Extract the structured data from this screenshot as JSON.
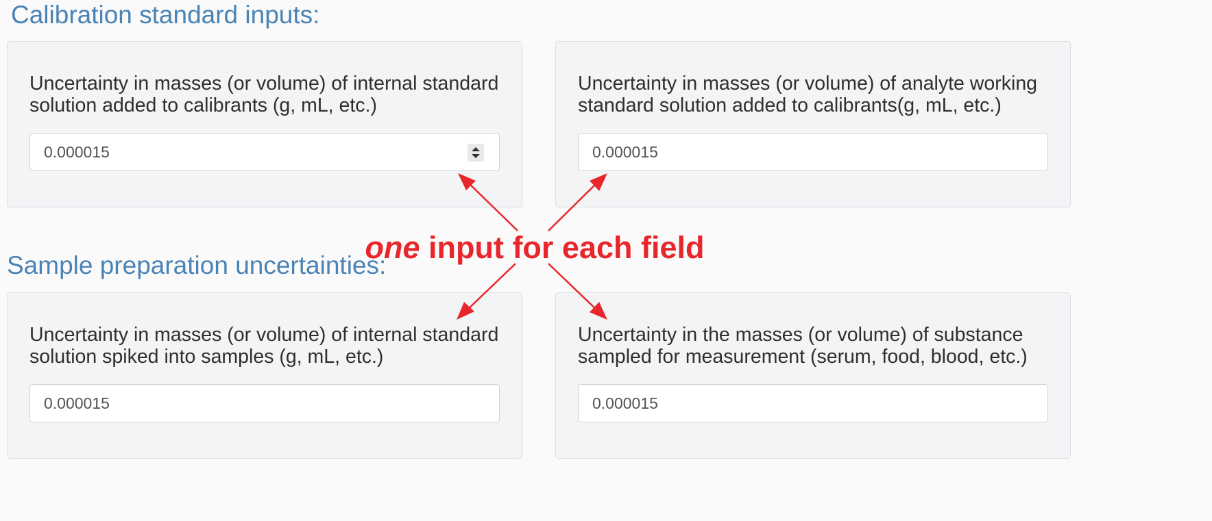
{
  "sections": {
    "calibration_title": "Calibration standard inputs:",
    "sample_title": "Sample preparation uncertainties:"
  },
  "fields": [
    {
      "label": "Uncertainty in masses (or volume) of internal standard solution added to calibrants (g, mL, etc.)",
      "value": "0.000015"
    },
    {
      "label": "Uncertainty in masses (or volume) of analyte working standard solution added to calibrants(g, mL, etc.)",
      "value": "0.000015"
    },
    {
      "label": "Uncertainty in masses (or volume) of internal standard solution spiked into samples (g, mL, etc.)",
      "value": "0.000015"
    },
    {
      "label": "Uncertainty in the masses (or volume) of substance sampled for measurement (serum, food, blood, etc.)",
      "value": "0.000015"
    }
  ],
  "annotation": {
    "emphasis": "one",
    "text": " input for each field",
    "color": "#e8262b"
  },
  "colors": {
    "section_title": "#4a83b5",
    "panel_background": "#f3f4f6",
    "page_background": "#fafafa"
  },
  "icons": {
    "spinner": "spinner-updown-icon",
    "arrow": "red-arrow-icon"
  }
}
